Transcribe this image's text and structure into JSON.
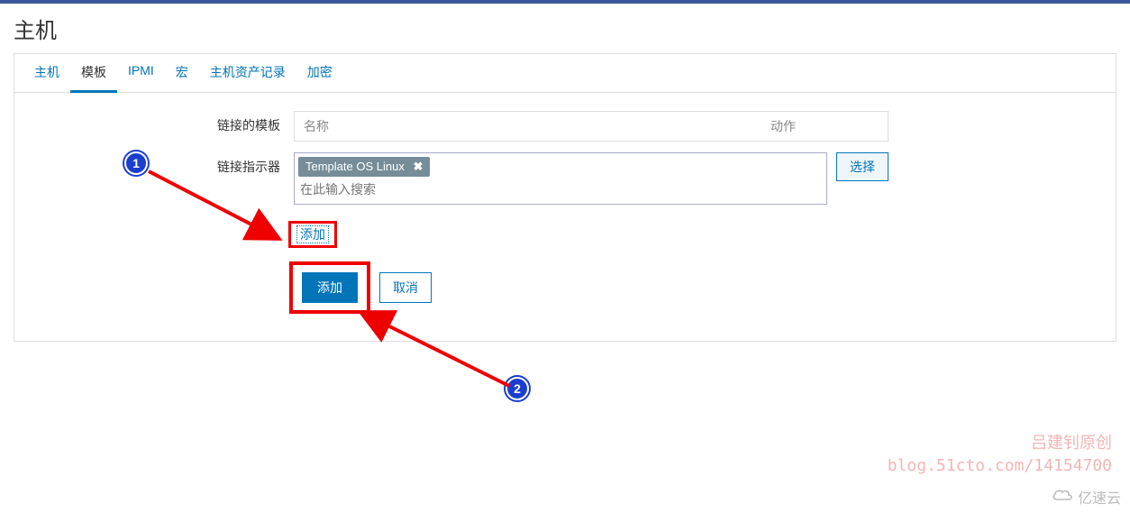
{
  "page": {
    "title": "主机"
  },
  "tabs": [
    {
      "label": "主机"
    },
    {
      "label": "模板",
      "active": true
    },
    {
      "label": "IPMI"
    },
    {
      "label": "宏"
    },
    {
      "label": "主机资产记录"
    },
    {
      "label": "加密"
    }
  ],
  "form": {
    "linked_templates_label": "链接的模板",
    "linked_header_name": "名称",
    "linked_header_action": "动作",
    "link_indicator_label": "链接指示器",
    "selected_template": "Template OS Linux",
    "tag_close": "✖",
    "search_placeholder": "在此输入搜索",
    "select_button": "选择",
    "add_link": "添加",
    "submit_button": "添加",
    "cancel_button": "取消"
  },
  "annotations": {
    "badge1": "1",
    "badge2": "2"
  },
  "watermark": {
    "line1": "吕建钊原创",
    "line2": "blog.51cto.com/14154700"
  },
  "brand": "亿速云"
}
